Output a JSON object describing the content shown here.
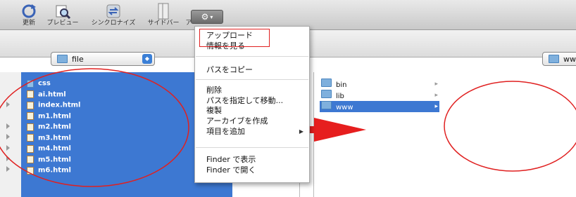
{
  "toolbar": {
    "items": [
      {
        "label": "更新",
        "icon": "refresh-icon"
      },
      {
        "label": "プレビュー",
        "icon": "preview-magnifier-icon"
      },
      {
        "label": "シンクロナイズ",
        "icon": "sync-icon"
      },
      {
        "label": "サイドバー",
        "icon": "sidebar-icon"
      },
      {
        "label": "ア",
        "icon": "action-icon"
      }
    ],
    "gear_glyph": "⚙",
    "gear_caret": "▾"
  },
  "pathbar": {
    "left_folder": "file",
    "right_folder": "ww"
  },
  "column2": {
    "files": [
      {
        "name": "css",
        "type": "folder"
      },
      {
        "name": "ai.html",
        "type": "html"
      },
      {
        "name": "index.html",
        "type": "html"
      },
      {
        "name": "m1.html",
        "type": "html"
      },
      {
        "name": "m2.html",
        "type": "html"
      },
      {
        "name": "m3.html",
        "type": "html"
      },
      {
        "name": "m4.html",
        "type": "html"
      },
      {
        "name": "m5.html",
        "type": "html"
      },
      {
        "name": "m6.html",
        "type": "html"
      }
    ]
  },
  "column4": {
    "items": [
      {
        "name": "bin",
        "selected": false
      },
      {
        "name": "lib",
        "selected": false
      },
      {
        "name": "www",
        "selected": true
      }
    ],
    "chevron": "▸"
  },
  "context_menu": {
    "items": [
      {
        "label": "アップロード"
      },
      {
        "label": "情報を見る"
      },
      {
        "label": "パスをコピー"
      },
      {
        "label": "削除"
      },
      {
        "label": "パスを指定して移動..."
      },
      {
        "label": "複製"
      },
      {
        "label": "アーカイブを作成"
      },
      {
        "label": "項目を追加",
        "submenu_arrow": "▶"
      },
      {
        "label": "Finder で表示"
      },
      {
        "label": "Finder で開く"
      }
    ]
  },
  "colors": {
    "selection": "#3d78d2",
    "annotation_red": "#e02020"
  }
}
